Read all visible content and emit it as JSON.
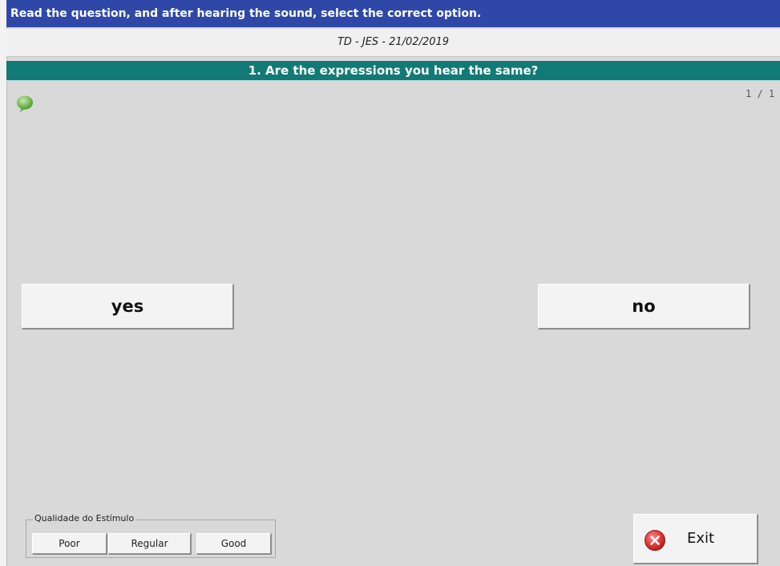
{
  "instruction": "Read the question, and after hearing the sound, select the correct option.",
  "session": "TD - JES - 21/02/2019",
  "question": "1. Are the expressions you hear the same?",
  "page_counter": "1 / 1",
  "answers": {
    "yes": "yes",
    "no": "no"
  },
  "quality": {
    "legend": "Qualidade do Estímulo",
    "poor": "Poor",
    "regular": "Regular",
    "good": "Good"
  },
  "exit": {
    "label": "Exit",
    "icon": "close-circle-icon"
  },
  "colors": {
    "instruction_bar": "#2f48a8",
    "question_bar": "#127a76",
    "background": "#d9d9d9",
    "exit_icon": "#e03b3b",
    "speech_icon": "#7dbf5a"
  }
}
